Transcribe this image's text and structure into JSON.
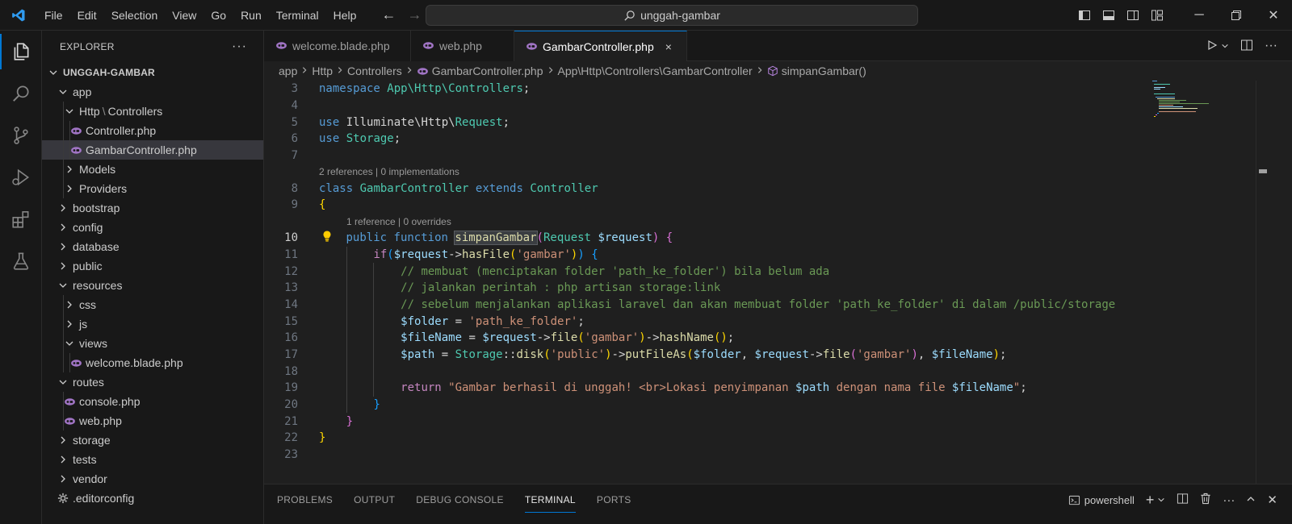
{
  "menu": [
    "File",
    "Edit",
    "Selection",
    "View",
    "Go",
    "Run",
    "Terminal",
    "Help"
  ],
  "search": {
    "text": "unggah-gambar"
  },
  "explorer": {
    "title": "EXPLORER",
    "root": "UNGGAH-GAMBAR",
    "items": [
      {
        "label": "app",
        "depth": 0,
        "type": "folder",
        "open": true
      },
      {
        "label": "Http",
        "label2": "Controllers",
        "depth": 1,
        "type": "folder",
        "open": true
      },
      {
        "label": "Controller.php",
        "depth": 2,
        "type": "php"
      },
      {
        "label": "GambarController.php",
        "depth": 2,
        "type": "php",
        "selected": true
      },
      {
        "label": "Models",
        "depth": 1,
        "type": "folder",
        "open": false
      },
      {
        "label": "Providers",
        "depth": 1,
        "type": "folder",
        "open": false
      },
      {
        "label": "bootstrap",
        "depth": 0,
        "type": "folder",
        "open": false
      },
      {
        "label": "config",
        "depth": 0,
        "type": "folder",
        "open": false
      },
      {
        "label": "database",
        "depth": 0,
        "type": "folder",
        "open": false
      },
      {
        "label": "public",
        "depth": 0,
        "type": "folder",
        "open": false
      },
      {
        "label": "resources",
        "depth": 0,
        "type": "folder",
        "open": true
      },
      {
        "label": "css",
        "depth": 1,
        "type": "folder",
        "open": false
      },
      {
        "label": "js",
        "depth": 1,
        "type": "folder",
        "open": false
      },
      {
        "label": "views",
        "depth": 1,
        "type": "folder",
        "open": true
      },
      {
        "label": "welcome.blade.php",
        "depth": 2,
        "type": "php"
      },
      {
        "label": "routes",
        "depth": 0,
        "type": "folder",
        "open": true
      },
      {
        "label": "console.php",
        "depth": 1,
        "type": "php"
      },
      {
        "label": "web.php",
        "depth": 1,
        "type": "php"
      },
      {
        "label": "storage",
        "depth": 0,
        "type": "folder",
        "open": false
      },
      {
        "label": "tests",
        "depth": 0,
        "type": "folder",
        "open": false
      },
      {
        "label": "vendor",
        "depth": 0,
        "type": "folder",
        "open": false
      },
      {
        "label": ".editorconfig",
        "depth": 0,
        "type": "gear"
      }
    ]
  },
  "tabs": [
    {
      "label": "welcome.blade.php",
      "active": false
    },
    {
      "label": "web.php",
      "active": false
    },
    {
      "label": "GambarController.php",
      "active": true,
      "close": "×"
    }
  ],
  "breadcrumbs": [
    "app",
    "Http",
    "Controllers",
    "GambarController.php",
    "App\\Http\\Controllers\\GambarController",
    "simpanGambar()"
  ],
  "code": {
    "lens_class": "2 references | 0 implementations",
    "lens_method": "1 reference | 0 overrides",
    "lines": [
      {
        "n": "3",
        "tokens": [
          [
            "kw",
            "namespace"
          ],
          [
            "plain",
            " "
          ],
          [
            "ns",
            "App\\Http\\Controllers"
          ],
          [
            "plain",
            ";"
          ]
        ]
      },
      {
        "n": "4",
        "tokens": []
      },
      {
        "n": "5",
        "tokens": [
          [
            "kw",
            "use"
          ],
          [
            "plain",
            " Illuminate\\Http\\"
          ],
          [
            "cls",
            "Request"
          ],
          [
            "plain",
            ";"
          ]
        ]
      },
      {
        "n": "6",
        "tokens": [
          [
            "kw",
            "use"
          ],
          [
            "plain",
            " "
          ],
          [
            "cls",
            "Storage"
          ],
          [
            "plain",
            ";"
          ]
        ]
      },
      {
        "n": "7",
        "tokens": []
      },
      {
        "n": "8",
        "lens": "class",
        "tokens": [
          [
            "kw",
            "class"
          ],
          [
            "plain",
            " "
          ],
          [
            "cls",
            "GambarController"
          ],
          [
            "plain",
            " "
          ],
          [
            "kw",
            "extends"
          ],
          [
            "plain",
            " "
          ],
          [
            "cls",
            "Controller"
          ]
        ]
      },
      {
        "n": "9",
        "tokens": [
          [
            "br1",
            "{"
          ]
        ]
      },
      {
        "n": "10",
        "lens": "method",
        "current": true,
        "tokens": [
          [
            "plain",
            "    "
          ],
          [
            "kw",
            "public"
          ],
          [
            "plain",
            " "
          ],
          [
            "kw",
            "function"
          ],
          [
            "plain",
            " "
          ],
          [
            "fnhl",
            "simpanGambar"
          ],
          [
            "br2",
            "("
          ],
          [
            "cls",
            "Request"
          ],
          [
            "plain",
            " "
          ],
          [
            "var",
            "$request"
          ],
          [
            "br2",
            ")"
          ],
          [
            "plain",
            " "
          ],
          [
            "br2",
            "{"
          ]
        ]
      },
      {
        "n": "11",
        "tokens": [
          [
            "plain",
            "        "
          ],
          [
            "ctl",
            "if"
          ],
          [
            "br3",
            "("
          ],
          [
            "var",
            "$request"
          ],
          [
            "plain",
            "->"
          ],
          [
            "fn",
            "hasFile"
          ],
          [
            "br1",
            "("
          ],
          [
            "str",
            "'gambar'"
          ],
          [
            "br1",
            ")"
          ],
          [
            "br3",
            ")"
          ],
          [
            "plain",
            " "
          ],
          [
            "br3",
            "{"
          ]
        ]
      },
      {
        "n": "12",
        "tokens": [
          [
            "plain",
            "            "
          ],
          [
            "cmt",
            "// membuat (menciptakan folder 'path_ke_folder') bila belum ada"
          ]
        ]
      },
      {
        "n": "13",
        "tokens": [
          [
            "plain",
            "            "
          ],
          [
            "cmt",
            "// jalankan perintah : php artisan storage:link"
          ]
        ]
      },
      {
        "n": "14",
        "tokens": [
          [
            "plain",
            "            "
          ],
          [
            "cmt",
            "// sebelum menjalankan aplikasi laravel dan akan membuat folder 'path_ke_folder' di dalam /public/storage"
          ]
        ]
      },
      {
        "n": "15",
        "tokens": [
          [
            "plain",
            "            "
          ],
          [
            "var",
            "$folder"
          ],
          [
            "plain",
            " = "
          ],
          [
            "str",
            "'path_ke_folder'"
          ],
          [
            "plain",
            ";"
          ]
        ]
      },
      {
        "n": "16",
        "tokens": [
          [
            "plain",
            "            "
          ],
          [
            "var",
            "$fileName"
          ],
          [
            "plain",
            " = "
          ],
          [
            "var",
            "$request"
          ],
          [
            "plain",
            "->"
          ],
          [
            "fn",
            "file"
          ],
          [
            "br1",
            "("
          ],
          [
            "str",
            "'gambar'"
          ],
          [
            "br1",
            ")"
          ],
          [
            "plain",
            "->"
          ],
          [
            "fn",
            "hashName"
          ],
          [
            "br1",
            "()"
          ],
          [
            "plain",
            ";"
          ]
        ]
      },
      {
        "n": "17",
        "tokens": [
          [
            "plain",
            "            "
          ],
          [
            "var",
            "$path"
          ],
          [
            "plain",
            " = "
          ],
          [
            "cls",
            "Storage"
          ],
          [
            "plain",
            "::"
          ],
          [
            "fn",
            "disk"
          ],
          [
            "br1",
            "("
          ],
          [
            "str",
            "'public'"
          ],
          [
            "br1",
            ")"
          ],
          [
            "plain",
            "->"
          ],
          [
            "fn",
            "putFileAs"
          ],
          [
            "br1",
            "("
          ],
          [
            "var",
            "$folder"
          ],
          [
            "plain",
            ", "
          ],
          [
            "var",
            "$request"
          ],
          [
            "plain",
            "->"
          ],
          [
            "fn",
            "file"
          ],
          [
            "br2",
            "("
          ],
          [
            "str",
            "'gambar'"
          ],
          [
            "br2",
            ")"
          ],
          [
            "plain",
            ", "
          ],
          [
            "var",
            "$fileName"
          ],
          [
            "br1",
            ")"
          ],
          [
            "plain",
            ";"
          ]
        ]
      },
      {
        "n": "18",
        "tokens": []
      },
      {
        "n": "19",
        "tokens": [
          [
            "plain",
            "            "
          ],
          [
            "ctl",
            "return"
          ],
          [
            "plain",
            " "
          ],
          [
            "str",
            "\"Gambar berhasil di unggah! <br>Lokasi penyimpanan "
          ],
          [
            "var",
            "$path"
          ],
          [
            "str",
            " dengan nama file "
          ],
          [
            "var",
            "$fileName"
          ],
          [
            "str",
            "\""
          ],
          [
            "plain",
            ";"
          ]
        ]
      },
      {
        "n": "20",
        "tokens": [
          [
            "plain",
            "        "
          ],
          [
            "br3",
            "}"
          ]
        ]
      },
      {
        "n": "21",
        "tokens": [
          [
            "plain",
            "    "
          ],
          [
            "br2",
            "}"
          ]
        ]
      },
      {
        "n": "22",
        "tokens": [
          [
            "br1",
            "}"
          ]
        ]
      },
      {
        "n": "23",
        "tokens": []
      }
    ]
  },
  "panel": {
    "tabs": [
      "PROBLEMS",
      "OUTPUT",
      "DEBUG CONSOLE",
      "TERMINAL",
      "PORTS"
    ],
    "active": "TERMINAL",
    "shell": "powershell"
  },
  "colors": {
    "accent": "#0078d4",
    "php_icon": "#a074c4"
  }
}
